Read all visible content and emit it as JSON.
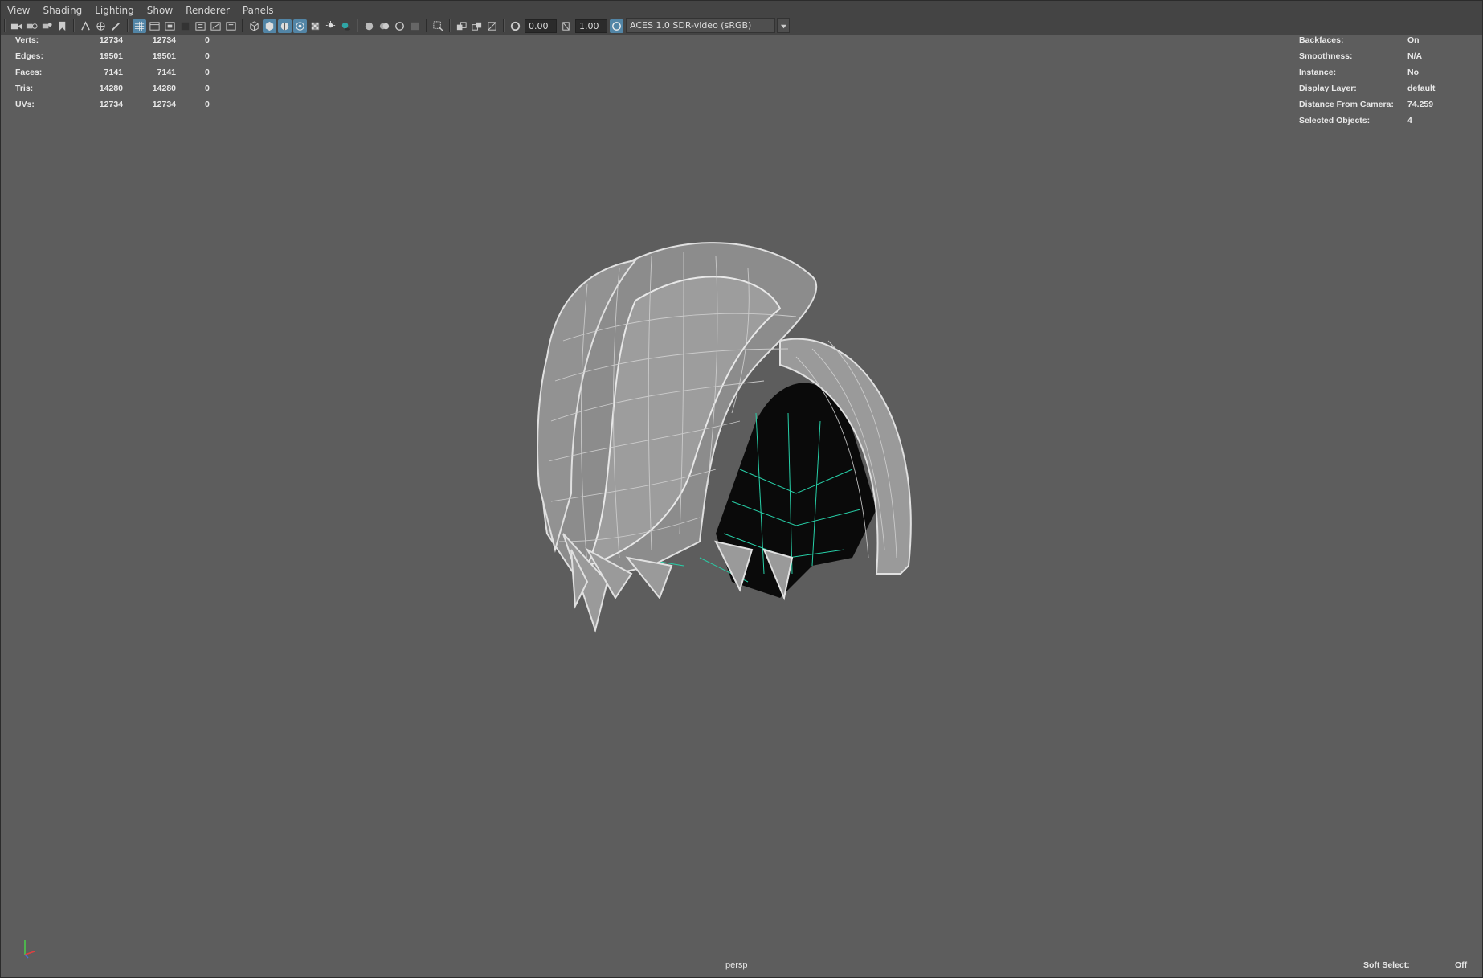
{
  "menu": [
    "View",
    "Shading",
    "Lighting",
    "Show",
    "Renderer",
    "Panels"
  ],
  "toolbar": {
    "exposure_value": "0.00",
    "gamma_value": "1.00",
    "color_space": "ACES 1.0 SDR-video (sRGB)"
  },
  "stats": [
    {
      "label": "Verts:",
      "v1": "12734",
      "v2": "12734",
      "v3": "0"
    },
    {
      "label": "Edges:",
      "v1": "19501",
      "v2": "19501",
      "v3": "0"
    },
    {
      "label": "Faces:",
      "v1": "7141",
      "v2": "7141",
      "v3": "0"
    },
    {
      "label": "Tris:",
      "v1": "14280",
      "v2": "14280",
      "v3": "0"
    },
    {
      "label": "UVs:",
      "v1": "12734",
      "v2": "12734",
      "v3": "0"
    }
  ],
  "info": [
    {
      "label": "Backfaces:",
      "value": "On"
    },
    {
      "label": "Smoothness:",
      "value": "N/A"
    },
    {
      "label": "Instance:",
      "value": "No"
    },
    {
      "label": "Display Layer:",
      "value": "default"
    },
    {
      "label": "Distance From Camera:",
      "value": "74.259"
    },
    {
      "label": "Selected Objects:",
      "value": "4"
    }
  ],
  "camera_name": "persp",
  "soft_select": {
    "label": "Soft Select:",
    "value": "Off"
  },
  "colors": {
    "viewport_bg": "#5d5d5d",
    "wire": "#d8d8d8",
    "selected_wire": "#27d0a8",
    "active_icon": "#5285a6"
  }
}
